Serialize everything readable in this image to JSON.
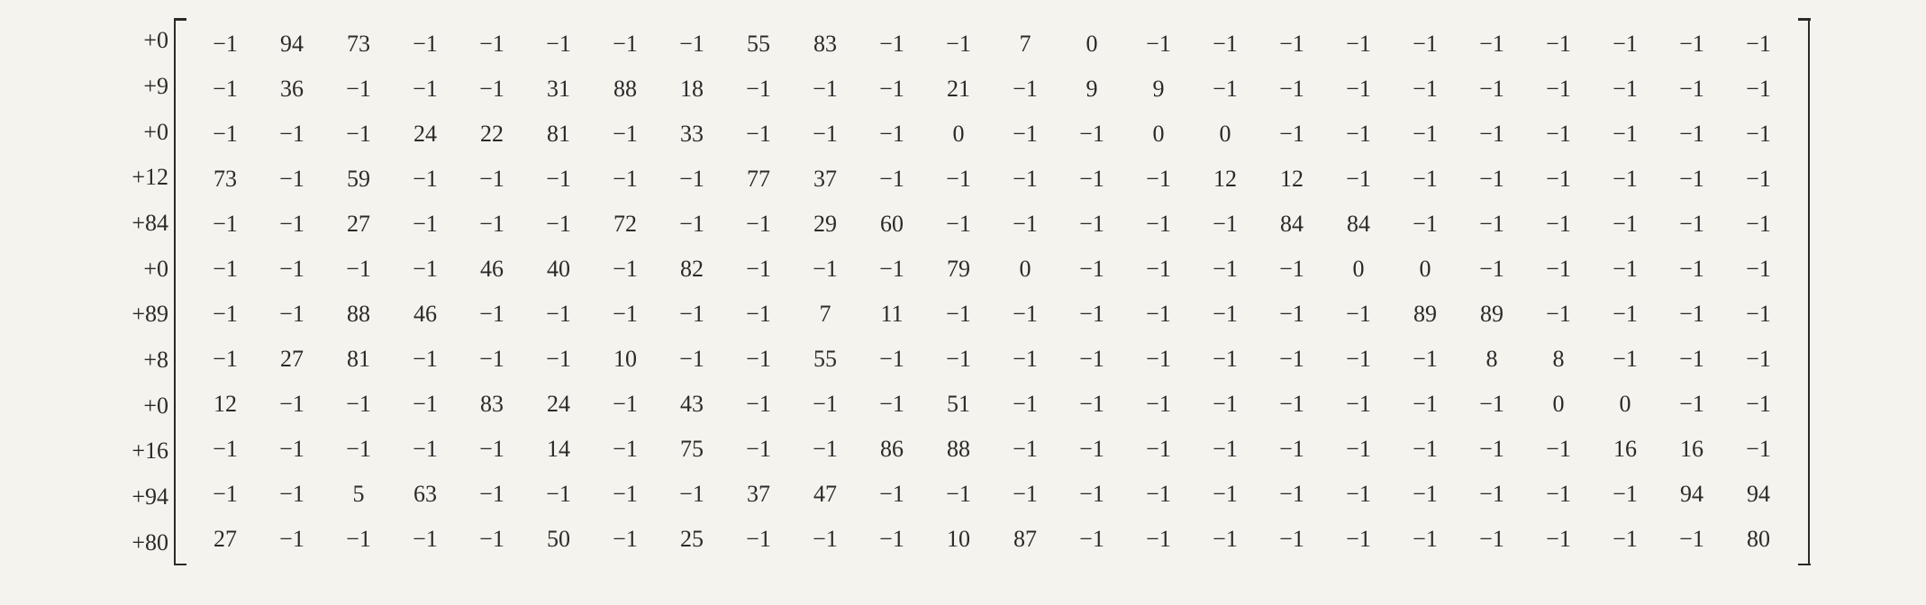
{
  "chart_data": {
    "type": "table",
    "title": "",
    "row_labels": [
      "+0",
      "+9",
      "+0",
      "+12",
      "+84",
      "+0",
      "+89",
      "+8",
      "+0",
      "+16",
      "+94",
      "+80"
    ],
    "matrix": [
      [
        -1,
        94,
        73,
        -1,
        -1,
        -1,
        -1,
        -1,
        55,
        83,
        -1,
        -1,
        7,
        0,
        -1,
        -1,
        -1,
        -1,
        -1,
        -1,
        -1,
        -1,
        -1,
        -1
      ],
      [
        -1,
        36,
        -1,
        -1,
        -1,
        31,
        88,
        18,
        -1,
        -1,
        -1,
        21,
        -1,
        9,
        9,
        -1,
        -1,
        -1,
        -1,
        -1,
        -1,
        -1,
        -1,
        -1
      ],
      [
        -1,
        -1,
        -1,
        24,
        22,
        81,
        -1,
        33,
        -1,
        -1,
        -1,
        0,
        -1,
        -1,
        0,
        0,
        -1,
        -1,
        -1,
        -1,
        -1,
        -1,
        -1,
        -1
      ],
      [
        73,
        -1,
        59,
        -1,
        -1,
        -1,
        -1,
        -1,
        77,
        37,
        -1,
        -1,
        -1,
        -1,
        -1,
        12,
        12,
        -1,
        -1,
        -1,
        -1,
        -1,
        -1,
        -1
      ],
      [
        -1,
        -1,
        27,
        -1,
        -1,
        -1,
        72,
        -1,
        -1,
        29,
        60,
        -1,
        -1,
        -1,
        -1,
        -1,
        84,
        84,
        -1,
        -1,
        -1,
        -1,
        -1,
        -1
      ],
      [
        -1,
        -1,
        -1,
        -1,
        46,
        40,
        -1,
        82,
        -1,
        -1,
        -1,
        79,
        0,
        -1,
        -1,
        -1,
        -1,
        0,
        0,
        -1,
        -1,
        -1,
        -1,
        -1
      ],
      [
        -1,
        -1,
        88,
        46,
        -1,
        -1,
        -1,
        -1,
        -1,
        7,
        11,
        -1,
        -1,
        -1,
        -1,
        -1,
        -1,
        -1,
        89,
        89,
        -1,
        -1,
        -1,
        -1
      ],
      [
        -1,
        27,
        81,
        -1,
        -1,
        -1,
        10,
        -1,
        -1,
        55,
        -1,
        -1,
        -1,
        -1,
        -1,
        -1,
        -1,
        -1,
        -1,
        8,
        8,
        -1,
        -1,
        -1
      ],
      [
        12,
        -1,
        -1,
        -1,
        83,
        24,
        -1,
        43,
        -1,
        -1,
        -1,
        51,
        -1,
        -1,
        -1,
        -1,
        -1,
        -1,
        -1,
        -1,
        0,
        0,
        -1,
        -1
      ],
      [
        -1,
        -1,
        -1,
        -1,
        -1,
        14,
        -1,
        75,
        -1,
        -1,
        86,
        88,
        -1,
        -1,
        -1,
        -1,
        -1,
        -1,
        -1,
        -1,
        -1,
        16,
        16,
        -1
      ],
      [
        -1,
        -1,
        5,
        63,
        -1,
        -1,
        -1,
        -1,
        37,
        47,
        -1,
        -1,
        -1,
        -1,
        -1,
        -1,
        -1,
        -1,
        -1,
        -1,
        -1,
        -1,
        94,
        94
      ],
      [
        27,
        -1,
        -1,
        -1,
        -1,
        50,
        -1,
        25,
        -1,
        -1,
        -1,
        10,
        87,
        -1,
        -1,
        -1,
        -1,
        -1,
        -1,
        -1,
        -1,
        -1,
        -1,
        80
      ]
    ]
  }
}
